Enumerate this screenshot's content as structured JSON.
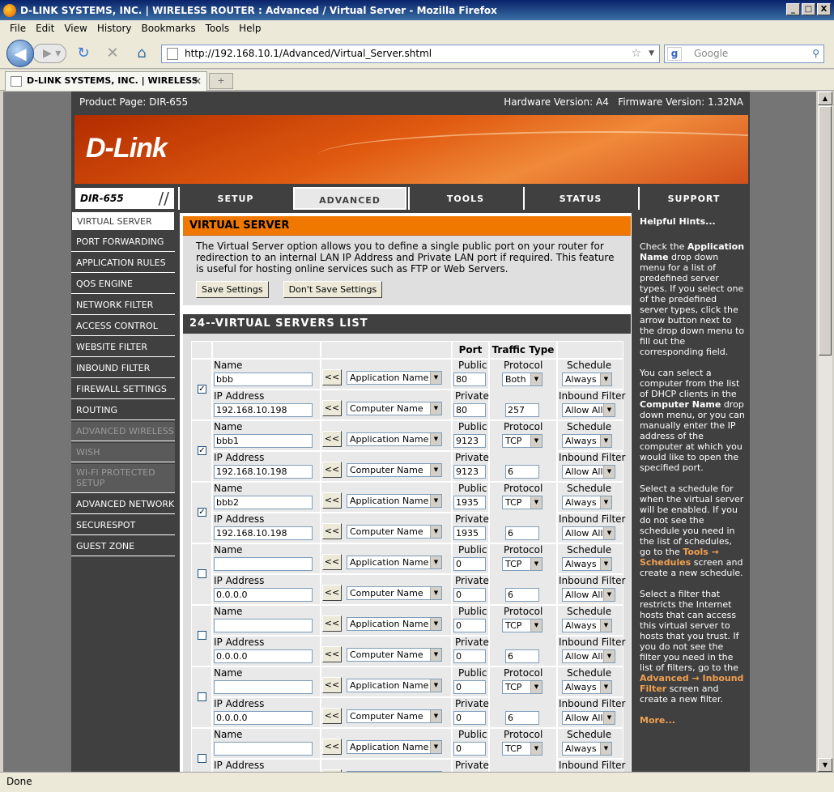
{
  "window": {
    "title": "D-LINK SYSTEMS, INC. | WIRELESS ROUTER : Advanced / Virtual Server - Mozilla Firefox",
    "min": "_",
    "max": "□",
    "close": "X"
  },
  "menu": [
    "File",
    "Edit",
    "View",
    "History",
    "Bookmarks",
    "Tools",
    "Help"
  ],
  "nav": {
    "url": "http://192.168.10.1/Advanced/Virtual_Server.shtml",
    "search_placeholder": "Google"
  },
  "tab": {
    "title": "D-LINK SYSTEMS, INC. | WIRELESS R...",
    "newtab": "+"
  },
  "status": "Done",
  "router": {
    "product_page": "Product Page: DIR-655",
    "hardware": "Hardware Version: A4",
    "firmware": "Firmware Version: 1.32NA",
    "logo": "D-Link",
    "model": "DIR-655",
    "tabs": [
      "SETUP",
      "ADVANCED",
      "TOOLS",
      "STATUS",
      "SUPPORT"
    ],
    "sidebar": [
      "VIRTUAL SERVER",
      "PORT FORWARDING",
      "APPLICATION RULES",
      "QOS ENGINE",
      "NETWORK FILTER",
      "ACCESS CONTROL",
      "WEBSITE FILTER",
      "INBOUND FILTER",
      "FIREWALL SETTINGS",
      "ROUTING",
      "ADVANCED WIRELESS",
      "WISH",
      "WI-FI PROTECTED SETUP",
      "ADVANCED NETWORK",
      "SECURESPOT",
      "GUEST ZONE"
    ],
    "vs_title": "VIRTUAL SERVER",
    "vs_desc": "The Virtual Server option allows you to define a single public port on your router for redirection to an internal LAN IP Address and Private LAN port if required. This feature is useful for hosting online services such as FTP or Web Servers.",
    "save": "Save Settings",
    "dont_save": "Don't Save Settings",
    "list_title": "24--VIRTUAL SERVERS LIST",
    "th_port": "Port",
    "th_traffic": "Traffic Type",
    "labels": {
      "name": "Name",
      "ip": "IP Address",
      "public": "Public",
      "private": "Private",
      "protocol": "Protocol",
      "schedule": "Schedule",
      "inbound": "Inbound Filter",
      "app_name": "Application Name",
      "comp_name": "Computer Name",
      "ll": "<<"
    },
    "rows": [
      {
        "checked": "✓",
        "name": "bbb",
        "ip": "192.168.10.198",
        "public": "80",
        "private": "80",
        "protocol": "Both",
        "proto_num": "257",
        "schedule": "Always",
        "filter": "Allow All"
      },
      {
        "checked": "✓",
        "name": "bbb1",
        "ip": "192.168.10.198",
        "public": "9123",
        "private": "9123",
        "protocol": "TCP",
        "proto_num": "6",
        "schedule": "Always",
        "filter": "Allow All"
      },
      {
        "checked": "✓",
        "name": "bbb2",
        "ip": "192.168.10.198",
        "public": "1935",
        "private": "1935",
        "protocol": "TCP",
        "proto_num": "6",
        "schedule": "Always",
        "filter": "Allow All"
      },
      {
        "checked": "",
        "name": "",
        "ip": "0.0.0.0",
        "public": "0",
        "private": "0",
        "protocol": "TCP",
        "proto_num": "6",
        "schedule": "Always",
        "filter": "Allow All"
      },
      {
        "checked": "",
        "name": "",
        "ip": "0.0.0.0",
        "public": "0",
        "private": "0",
        "protocol": "TCP",
        "proto_num": "6",
        "schedule": "Always",
        "filter": "Allow All"
      },
      {
        "checked": "",
        "name": "",
        "ip": "0.0.0.0",
        "public": "0",
        "private": "0",
        "protocol": "TCP",
        "proto_num": "6",
        "schedule": "Always",
        "filter": "Allow All"
      },
      {
        "checked": "",
        "name": "",
        "ip": "",
        "public": "0",
        "private": "",
        "protocol": "TCP",
        "proto_num": "",
        "schedule": "Always",
        "filter": ""
      }
    ],
    "hints": {
      "title": "Helpful Hints...",
      "p1a": "Check the ",
      "p1b": "Application Name",
      "p1c": " drop down menu for a list of predefined server types. If you select one of the predefined server types, click the arrow button next to the drop down menu to fill out the corresponding field.",
      "p2a": "You can select a computer from the list of DHCP clients in the ",
      "p2b": "Computer Name",
      "p2c": " drop down menu, or you can manually enter the IP address of the computer at which you would like to open the specified port.",
      "p3a": "Select a schedule for when the virtual server will be enabled. If you do not see the schedule you need in the list of schedules, go to the ",
      "p3b": "Tools → Schedules",
      "p3c": " screen and create a new schedule.",
      "p4a": "Select a filter that restricts the Internet hosts that can access this virtual server to hosts that you trust. If you do not see the filter you need in the list of filters, go to the ",
      "p4b": "Advanced → Inbound Filter",
      "p4c": " screen and create a new filter.",
      "more": "More..."
    }
  }
}
